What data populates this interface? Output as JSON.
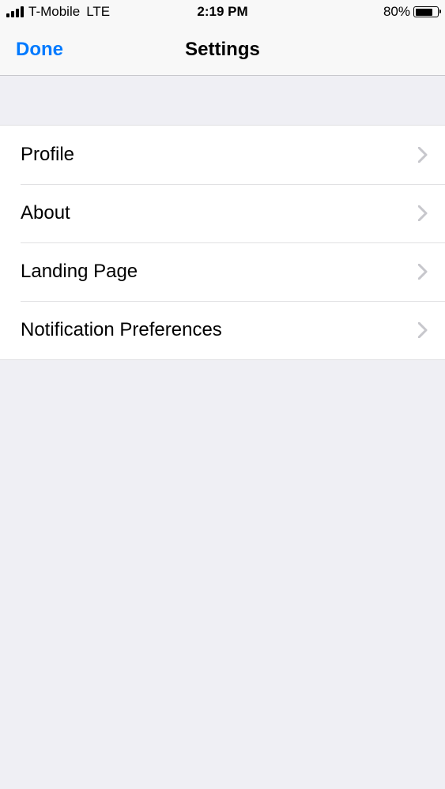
{
  "status_bar": {
    "carrier": "T-Mobile",
    "network": "LTE",
    "time": "2:19 PM",
    "battery_percent": "80%"
  },
  "nav": {
    "left_action": "Done",
    "title": "Settings"
  },
  "settings": {
    "items": [
      {
        "label": "Profile"
      },
      {
        "label": "About"
      },
      {
        "label": "Landing Page"
      },
      {
        "label": "Notification Preferences"
      }
    ]
  }
}
